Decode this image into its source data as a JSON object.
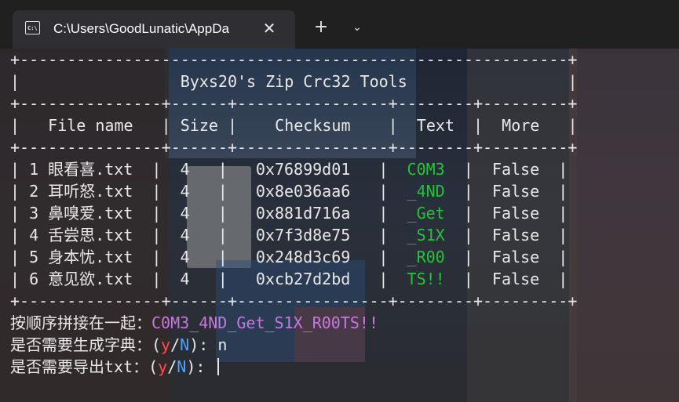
{
  "tab": {
    "icon": "terminal-icon",
    "title": "C:\\Users\\GoodLunatic\\AppDa",
    "close_label": "✕",
    "new_tab_label": "+",
    "dropdown_label": "⌄"
  },
  "table": {
    "border_top": "+-----------------------------------------------------------------------+",
    "title_row": "|                  Byxs20's Zip Crc32 Tools                              |",
    "border_mid": "+---------------+------+----------------+--------+--------+",
    "header": [
      "File name",
      "Size",
      "Checksum",
      "Text",
      "More"
    ],
    "rows": [
      {
        "name": "1 眼看喜.txt",
        "size": "4",
        "checksum": "0x76899d01",
        "text": "C0M3",
        "more": "False"
      },
      {
        "name": "2 耳听怒.txt",
        "size": "4",
        "checksum": "0x8e036aa6",
        "text": "_4ND",
        "more": "False"
      },
      {
        "name": "3 鼻嗅爱.txt",
        "size": "4",
        "checksum": "0x881d716a",
        "text": "_Get",
        "more": "False"
      },
      {
        "name": "4 舌尝思.txt",
        "size": "4",
        "checksum": "0x7f3d8e75",
        "text": "_S1X",
        "more": "False"
      },
      {
        "name": "5 身本忧.txt",
        "size": "4",
        "checksum": "0x248d3c69",
        "text": "_R00",
        "more": "False"
      },
      {
        "name": "6 意见欲.txt",
        "size": "4",
        "checksum": "0xcb27d2bd",
        "text": "TS!!",
        "more": "False"
      }
    ]
  },
  "output": {
    "concat_label": "按顺序拼接在一起：",
    "concat_value": "C0M3_4ND_Get_S1X_R00TS!!",
    "dict_prompt": "是否需要生成字典：(",
    "dict_answer": "n",
    "export_prompt": "是否需要导出txt：(",
    "y": "y",
    "slash": "/",
    "N": "N",
    "close_paren": "): "
  }
}
